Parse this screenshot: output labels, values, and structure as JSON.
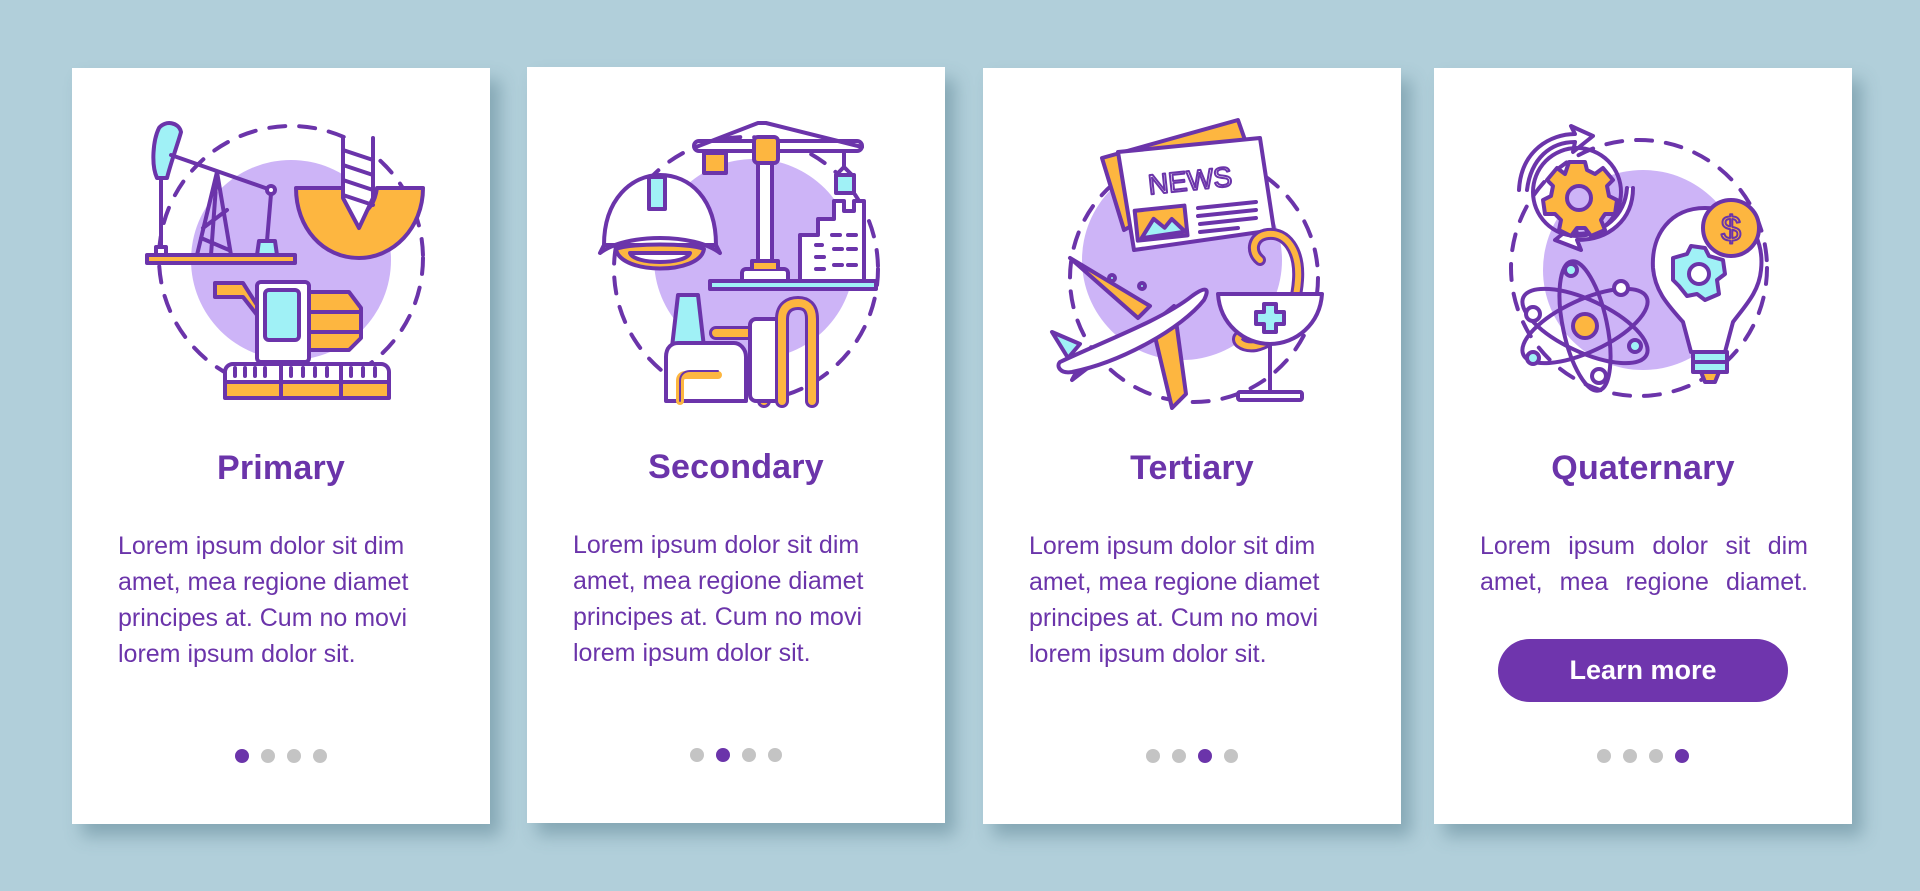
{
  "theme": {
    "background": "#b1cfda",
    "accent": "#6b34aa",
    "button": "#6f35ad",
    "circle_fill": "#cdb4f7",
    "orange": "#fdb640",
    "cyan": "#a0f1f6",
    "dot_inactive": "#c4c4c4"
  },
  "cards": [
    {
      "title": "Primary",
      "icon": "primary-sector-icon",
      "body": "Lorem ipsum dolor sit dim amet, mea regione diamet principes at. Cum no movi lorem ipsum dolor sit.",
      "pager": {
        "total": 4,
        "active": 1
      }
    },
    {
      "title": "Secondary",
      "icon": "secondary-sector-icon",
      "body": "Lorem ipsum dolor sit dim amet, mea regione diamet principes at. Cum no movi lorem ipsum dolor sit.",
      "pager": {
        "total": 4,
        "active": 2
      }
    },
    {
      "title": "Tertiary",
      "icon": "tertiary-sector-icon",
      "news_label": "NEWS",
      "body": "Lorem ipsum dolor sit dim amet, mea regione diamet principes at. Cum no movi lorem ipsum dolor sit.",
      "pager": {
        "total": 4,
        "active": 3
      }
    },
    {
      "title": "Quaternary",
      "icon": "quaternary-sector-icon",
      "coin_symbol": "$",
      "body": "Lorem ipsum dolor sit dim amet, mea regione diamet.",
      "button_label": "Learn more",
      "pager": {
        "total": 4,
        "active": 4
      }
    }
  ]
}
